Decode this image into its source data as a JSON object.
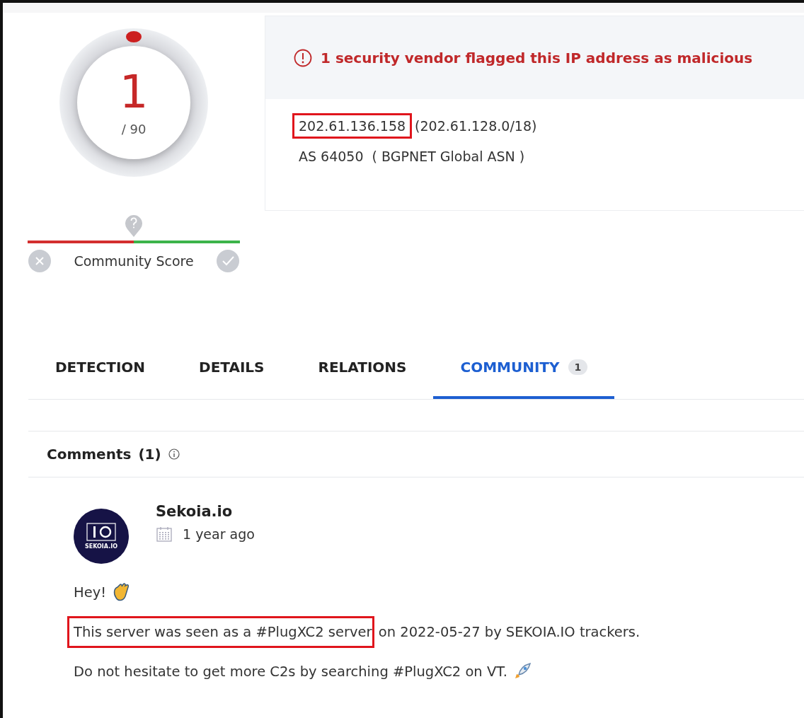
{
  "score": {
    "detections": "1",
    "total": "/ 90"
  },
  "community_score": {
    "label": "Community Score"
  },
  "summary": {
    "alert": "1 security vendor flagged this IP address as malicious",
    "ip": {
      "text": "202.61.136.158",
      "highlighted": true
    },
    "range": "(202.61.128.0/18)",
    "asn": "AS 64050  ( BGPNET Global ASN )"
  },
  "tabs": [
    {
      "label": "DETECTION",
      "selected": false
    },
    {
      "label": "DETAILS",
      "selected": false
    },
    {
      "label": "RELATIONS",
      "selected": false
    },
    {
      "label": "COMMUNITY",
      "selected": true,
      "count": "1"
    }
  ],
  "comments": {
    "title": "Comments",
    "count": "(1)",
    "items": [
      {
        "author": "Sekoia.io",
        "avatar_text": "SEKOIA.IO",
        "time": "1 year ago",
        "paragraphs": [
          {
            "kind": "wave",
            "parts": [
              {
                "text": "Hey!",
                "highlighted": false
              }
            ]
          },
          {
            "kind": "plain",
            "parts": [
              {
                "text": "This server was seen as a #PlugXC2 server",
                "highlighted": true
              },
              {
                "text": " on 2022-05-27 by SEKOIA.IO trackers.",
                "highlighted": false
              }
            ]
          },
          {
            "kind": "rocket",
            "parts": [
              {
                "text": "Do not hesitate to get more C2s by searching #PlugXC2 on VT.",
                "highlighted": false
              }
            ]
          }
        ]
      }
    ]
  }
}
